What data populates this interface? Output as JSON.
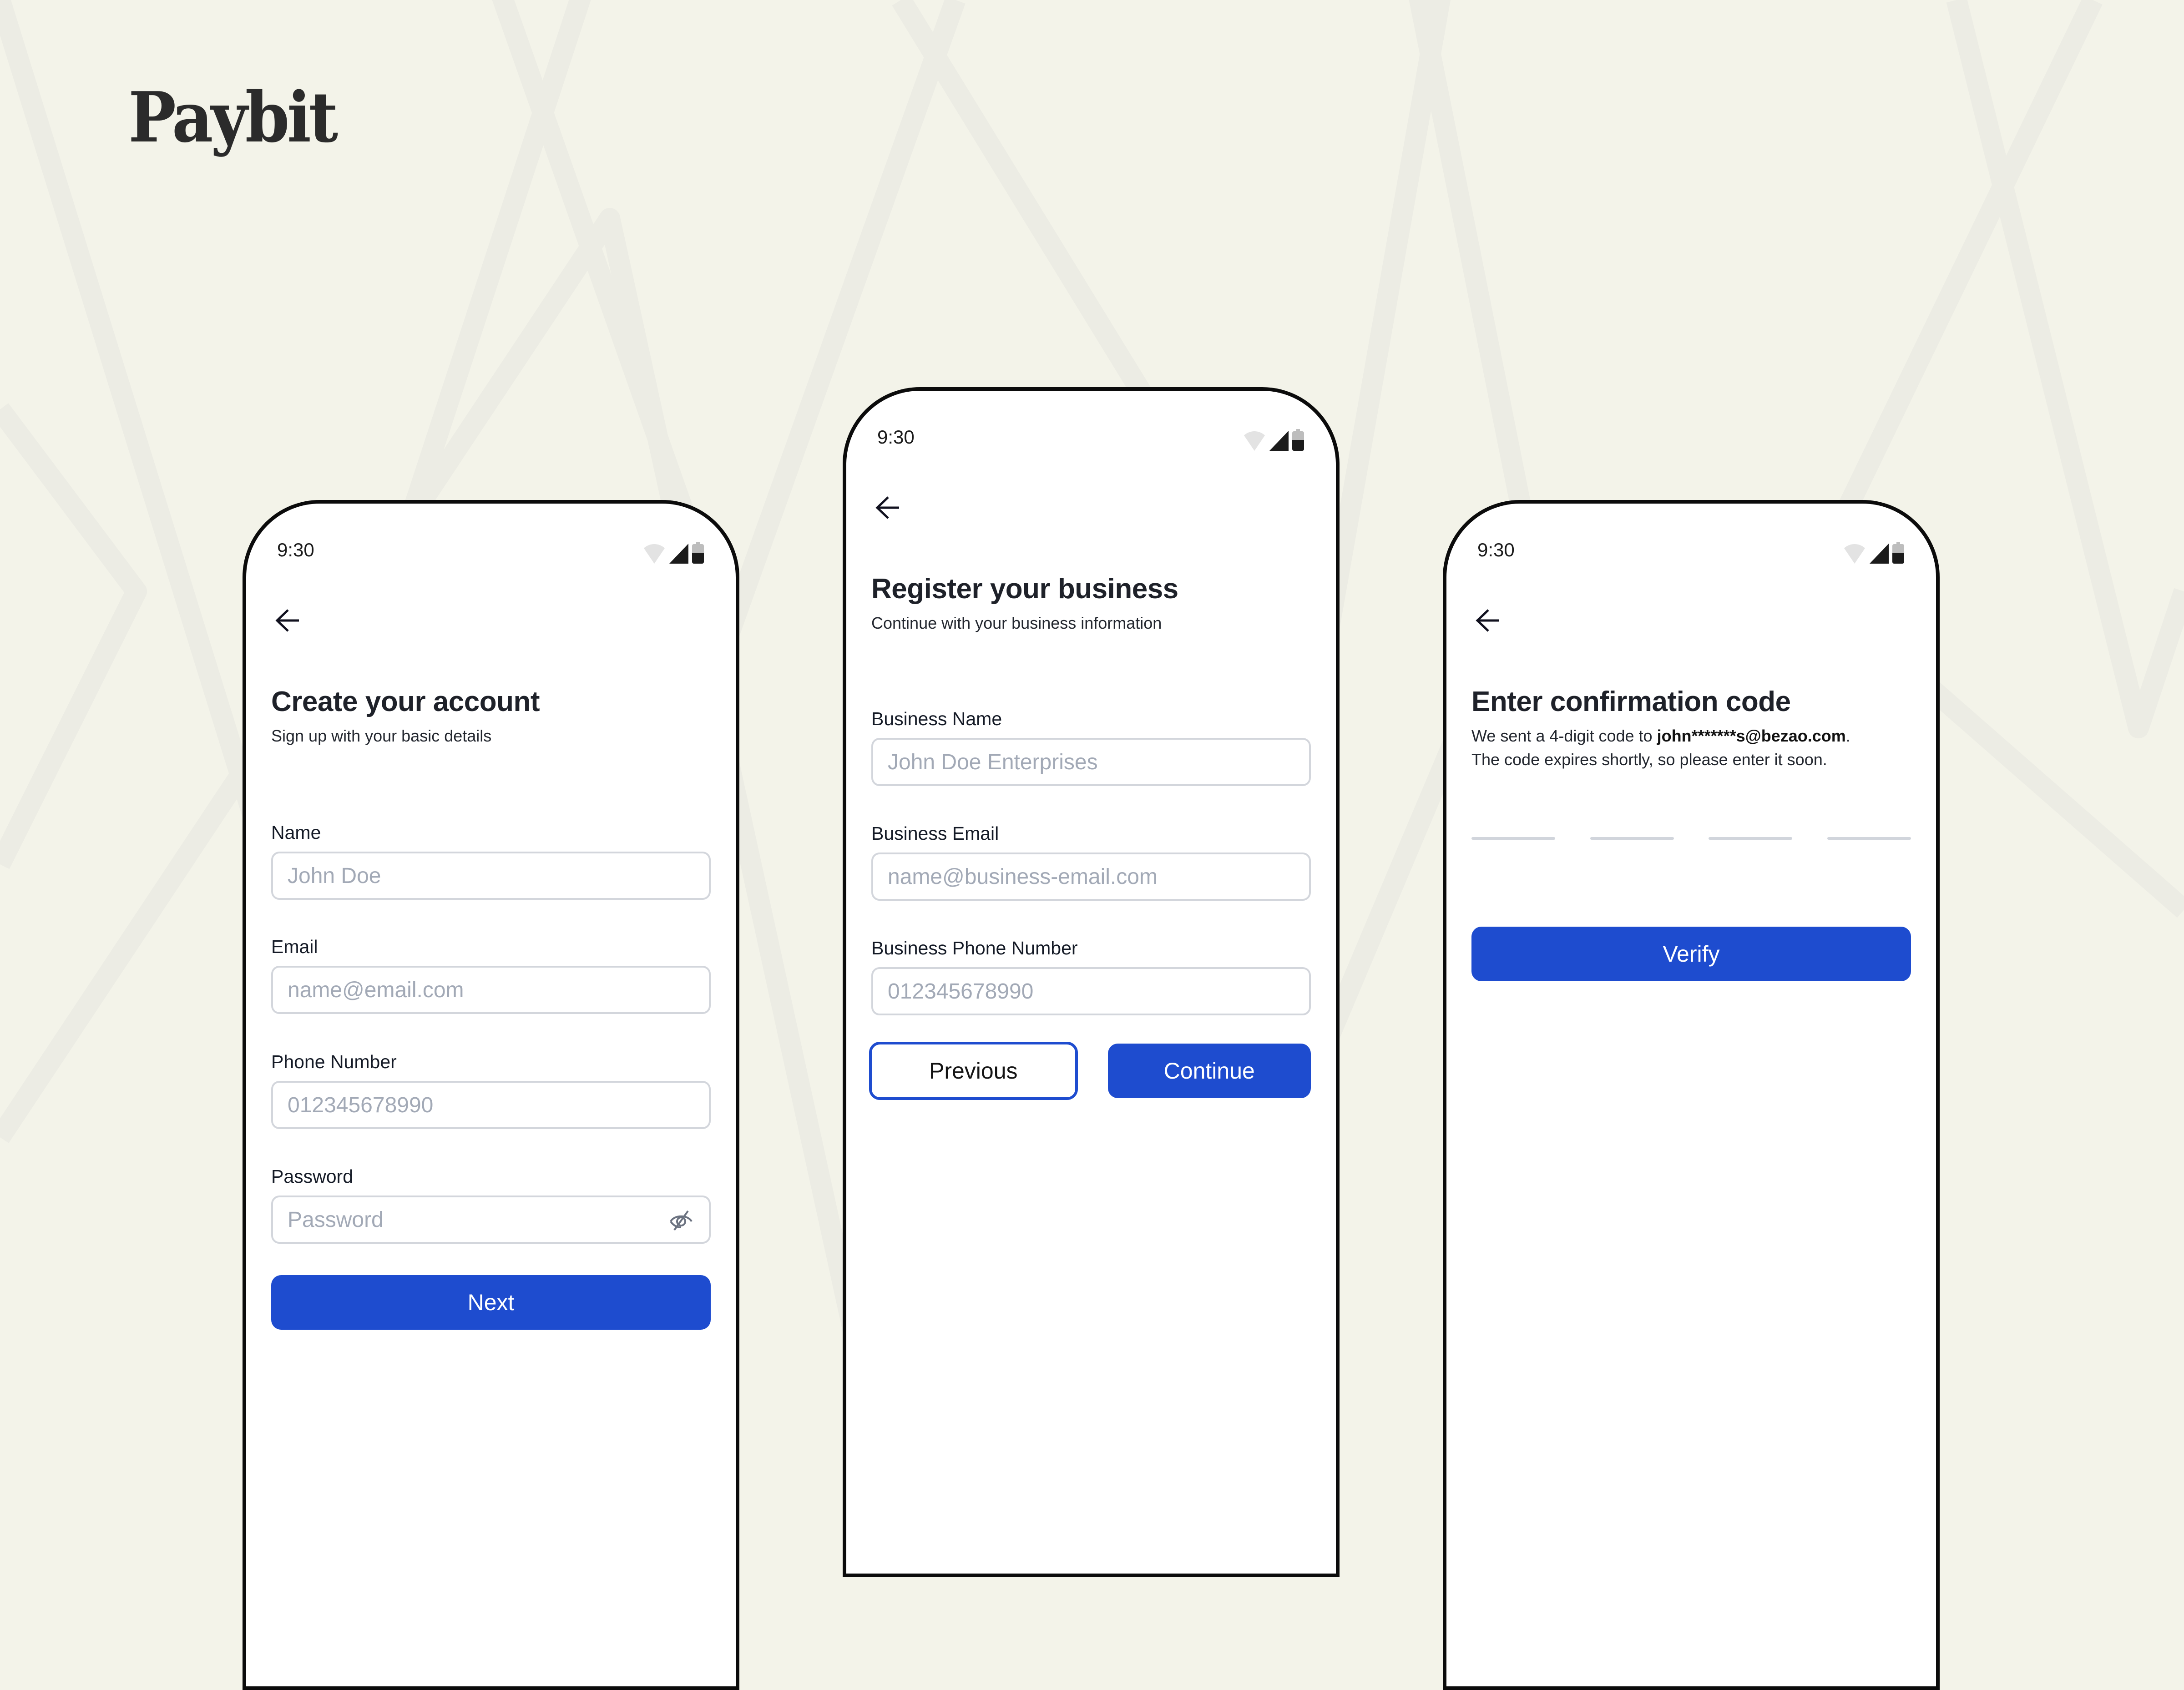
{
  "brand": {
    "name": "Paybit"
  },
  "colors": {
    "background": "#f3f3e9",
    "primary": "#1e4ccf",
    "input_border": "#d3d6dc",
    "placeholder": "#a2a9b6",
    "text": "#1e2129"
  },
  "status_bar": {
    "time": "9:30",
    "icons": [
      "wifi-icon",
      "signal-icon",
      "battery-icon"
    ]
  },
  "screens": {
    "create_account": {
      "back_icon": "arrow-left-icon",
      "title": "Create your account",
      "subtitle": "Sign up with your basic details",
      "fields": [
        {
          "label": "Name",
          "placeholder": "John Doe",
          "value": ""
        },
        {
          "label": "Email",
          "placeholder": "name@email.com",
          "value": ""
        },
        {
          "label": "Phone Number",
          "placeholder": "012345678990",
          "value": ""
        },
        {
          "label": "Password",
          "placeholder": "Password",
          "value": "",
          "toggle_icon": "eye-off-icon"
        }
      ],
      "next_label": "Next"
    },
    "register_business": {
      "back_icon": "arrow-left-icon",
      "title": "Register your business",
      "subtitle": "Continue with your business information",
      "fields": [
        {
          "label": "Business Name",
          "placeholder": "John Doe Enterprises",
          "value": ""
        },
        {
          "label": "Business Email",
          "placeholder": "name@business-email.com",
          "value": ""
        },
        {
          "label": "Business Phone Number",
          "placeholder": "012345678990",
          "value": ""
        }
      ],
      "previous_label": "Previous",
      "continue_label": "Continue"
    },
    "confirm_code": {
      "back_icon": "arrow-left-icon",
      "title": "Enter confirmation code",
      "message_prefix": "We sent a 4-digit code to ",
      "masked_email": "john*******s@bezao.com",
      "message_suffix": ".",
      "message_line2": "The code expires shortly, so please enter it soon.",
      "code_digits": [
        "",
        "",
        "",
        ""
      ],
      "verify_label": "Verify"
    }
  }
}
